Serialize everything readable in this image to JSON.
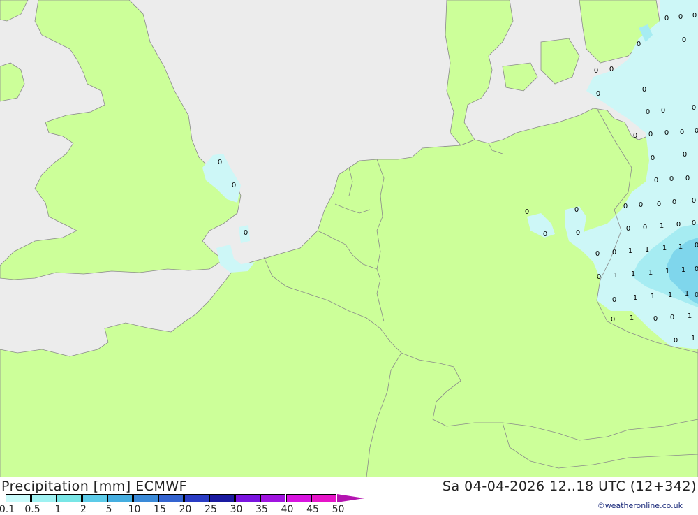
{
  "header": {
    "title": "Precipitation [mm] ECMWF",
    "datetime": "Sa 04-04-2026 12..18 UTC (12+342)"
  },
  "legend": {
    "ticks": [
      "0.1",
      "0.5",
      "1",
      "2",
      "5",
      "10",
      "15",
      "20",
      "25",
      "30",
      "35",
      "40",
      "45",
      "50"
    ],
    "colors": [
      "#c8fafa",
      "#9ff2f2",
      "#78e6e6",
      "#5ccbe8",
      "#45aee0",
      "#3a8ad8",
      "#3464d0",
      "#2a3cc4",
      "#1a1aa0",
      "#7a14e0",
      "#a014e0",
      "#d814e0",
      "#e614c8",
      "#b414b0"
    ]
  },
  "credit": "©weatheronline.co.uk",
  "map": {
    "colors": {
      "sea": "#ececec",
      "land": "#ccff99",
      "rain_light": "#cdf7f7",
      "rain_mid": "#a6ecf2",
      "rain_heavy": "#7fd6ec",
      "border": "#8a8a8a"
    },
    "value_labels": [
      "0",
      "0",
      "0",
      "0",
      "0",
      "0",
      "0",
      "0",
      "0",
      "0",
      "0",
      "0",
      "0",
      "0",
      "0",
      "0",
      "0",
      "0",
      "0",
      "0",
      "0",
      "0",
      "0",
      "0",
      "0",
      "0",
      "0",
      "0",
      "0",
      "0",
      "0",
      "0",
      "0",
      "0",
      "0",
      "0",
      "0",
      "0",
      "0",
      "0",
      "0",
      "1",
      "0",
      "0",
      "0",
      "0",
      "0",
      "1",
      "1",
      "1",
      "1",
      "1",
      "0",
      "1",
      "1",
      "1",
      "1",
      "1",
      "1",
      "1",
      "1",
      "0",
      "1",
      "1",
      "0",
      "1"
    ]
  }
}
